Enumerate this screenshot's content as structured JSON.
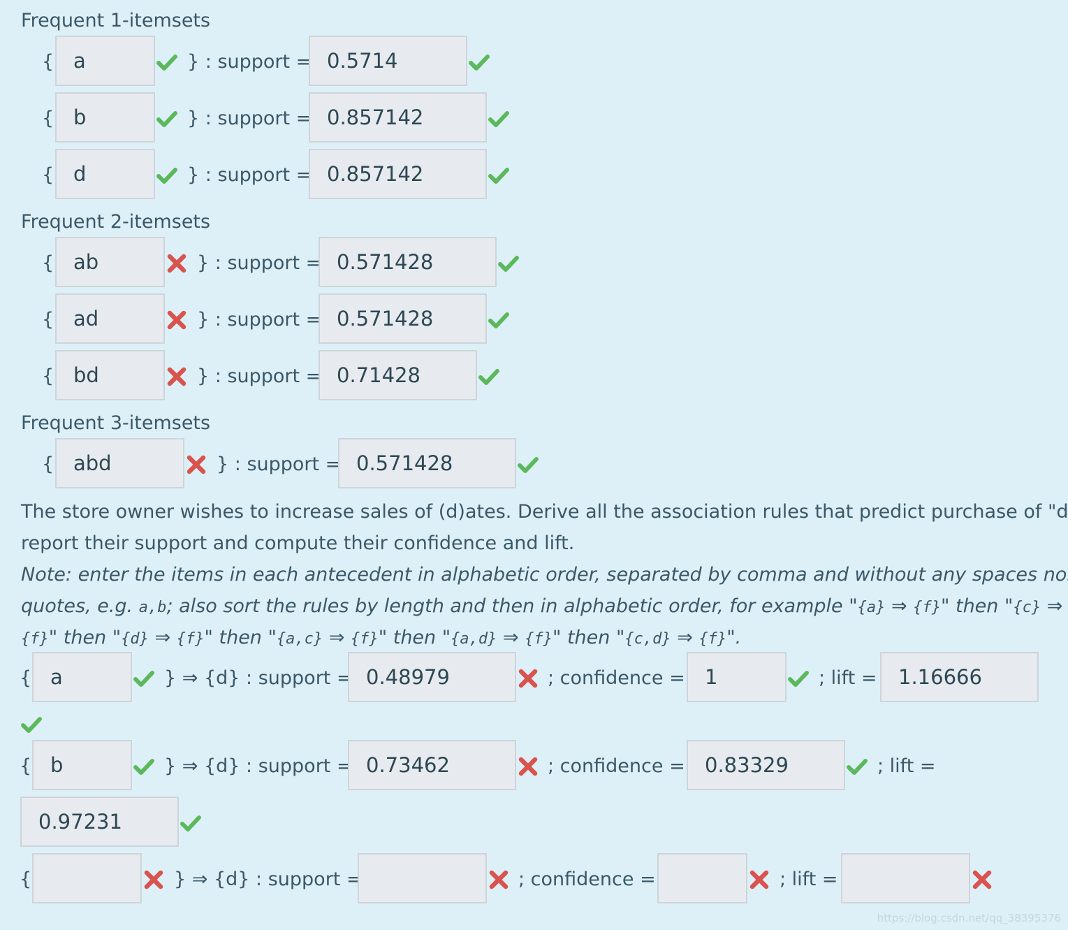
{
  "headings": {
    "h1": "Frequent 1-itemsets",
    "h2": "Frequent 2-itemsets",
    "h3": "Frequent 3-itemsets"
  },
  "labels": {
    "open_brace": "{",
    "support_suffix": "} : support =",
    "rule_suffix": "} ⇒ {d} : support =",
    "confidence": "; confidence =",
    "lift": "; lift ="
  },
  "itemsets1": [
    {
      "item": "a",
      "item_status": "correct",
      "support": "0.5714",
      "support_status": "correct"
    },
    {
      "item": "b",
      "item_status": "correct",
      "support": "0.857142",
      "support_status": "correct"
    },
    {
      "item": "d",
      "item_status": "correct",
      "support": "0.857142",
      "support_status": "correct"
    }
  ],
  "itemsets2": [
    {
      "item": "ab",
      "item_status": "incorrect",
      "support": "0.571428",
      "support_status": "correct"
    },
    {
      "item": "ad",
      "item_status": "incorrect",
      "support": "0.571428",
      "support_status": "correct"
    },
    {
      "item": "bd",
      "item_status": "incorrect",
      "support": "0.71428",
      "support_status": "correct"
    }
  ],
  "itemsets3": [
    {
      "item": "abd",
      "item_status": "incorrect",
      "support": "0.571428",
      "support_status": "correct"
    }
  ],
  "question": {
    "line1": "The store owner wishes to increase sales of (d)ates. Derive all the association rules that predict purchase of \"d\",",
    "line2": "report their support and compute their confidence and lift.",
    "note_l1": "Note: enter the items in each antecedent in alphabetic order, separated by comma and without any spaces nor",
    "note_l2_a": "quotes, e.g. ",
    "note_l2_code1": "a,b",
    "note_l2_b": "; also sort the rules by length and then in alphabetic order, for example \"",
    "note_l2_code2": "{a}",
    "note_l2_code3": "{f}",
    "note_l2_c": "\" then \"",
    "note_l2_code4": "{c}",
    "note_l3_code1": "{f}",
    "note_l3_a": "\" then \"",
    "note_l3_code2": "{d}",
    "note_l3_code3": "{f}",
    "note_l3_b": "\" then \"",
    "note_l3_code4": "{a,c}",
    "note_l3_code5": "{f}",
    "note_l3_c": "\" then \"",
    "note_l3_code6": "{a,d}",
    "note_l3_code7": "{f}",
    "note_l3_d": "\" then \"",
    "note_l3_code8": "{c,d}",
    "note_l3_code9": "{f}",
    "note_l3_e": "\".",
    "arrow": "⇒"
  },
  "rules": [
    {
      "antecedent": "a",
      "antecedent_status": "correct",
      "support": "0.48979",
      "support_status": "incorrect",
      "confidence": "1",
      "confidence_status": "correct",
      "lift": "1.16666",
      "lift_status": "correct"
    },
    {
      "antecedent": "b",
      "antecedent_status": "correct",
      "support": "0.73462",
      "support_status": "incorrect",
      "confidence": "0.83329",
      "confidence_status": "correct",
      "lift": "0.97231",
      "lift_status": "correct"
    },
    {
      "antecedent": "",
      "antecedent_status": "incorrect",
      "support": "",
      "support_status": "incorrect",
      "confidence": "",
      "confidence_status": "incorrect",
      "lift": "",
      "lift_status": "incorrect"
    }
  ],
  "watermark": "https://blog.csdn.net/qq_38395376",
  "colors": {
    "background": "#def0f7",
    "text": "#3a5868",
    "input_bg": "#e7ebef",
    "correct": "#5cb85c",
    "incorrect": "#d9534f"
  },
  "icons": {
    "correct": "check-icon",
    "incorrect": "cross-icon"
  }
}
